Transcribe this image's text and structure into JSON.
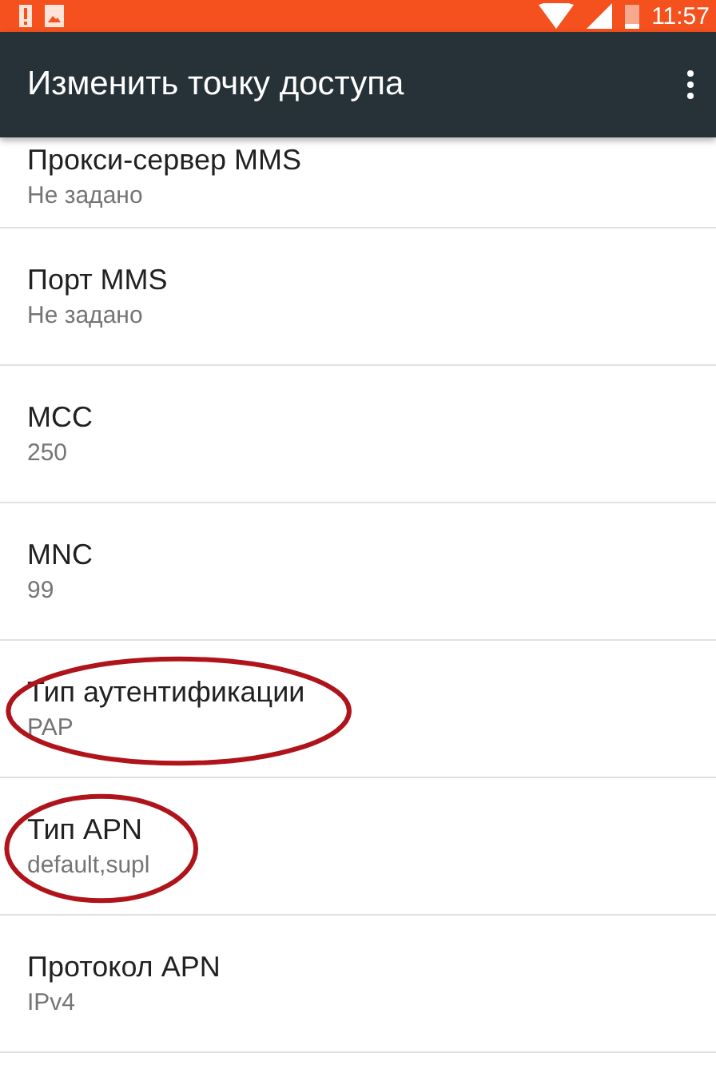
{
  "status_bar": {
    "time": "11:57"
  },
  "toolbar": {
    "title": "Изменить точку доступа"
  },
  "settings": [
    {
      "title": "Прокси-сервер MMS",
      "value": "Не задано",
      "circled": false
    },
    {
      "title": "Порт MMS",
      "value": "Не задано",
      "circled": false
    },
    {
      "title": "MCC",
      "value": "250",
      "circled": false
    },
    {
      "title": "MNC",
      "value": "99",
      "circled": false
    },
    {
      "title": "Тип аутентификации",
      "value": "PAP",
      "circled": true
    },
    {
      "title": "Тип APN",
      "value": "default,supl",
      "circled": true
    },
    {
      "title": "Протокол APN",
      "value": "IPv4",
      "circled": false
    }
  ]
}
